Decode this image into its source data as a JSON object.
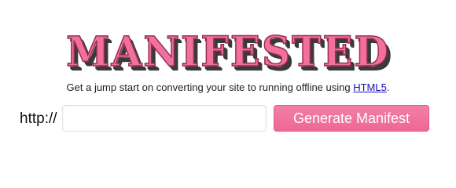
{
  "header": {
    "logo_text": "MANIFESTED"
  },
  "tagline": {
    "text": "Get a jump start on converting your site to running offline using ",
    "link_text": "HTML5",
    "suffix": "."
  },
  "form": {
    "prefix_label": "http://",
    "url_value": "",
    "url_placeholder": "",
    "submit_label": "Generate Manifest"
  },
  "colors": {
    "brand_pink": "#f2709e",
    "button_pink": "#ee6795",
    "link_blue": "#1a0dab"
  }
}
